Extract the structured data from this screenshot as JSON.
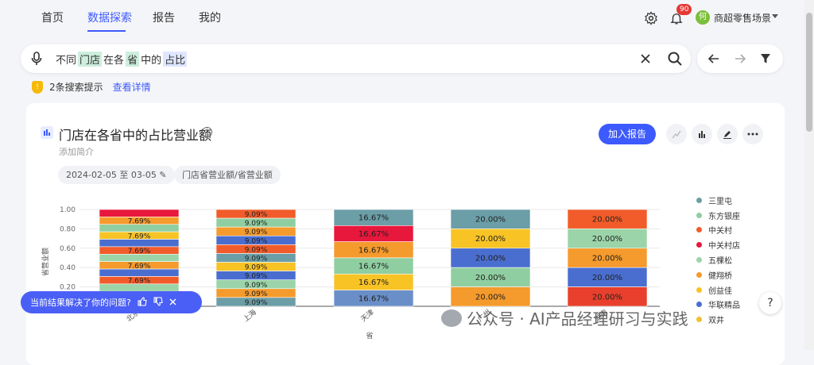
{
  "nav": {
    "items": [
      {
        "label": "首页",
        "active": false
      },
      {
        "label": "数据探索",
        "active": true
      },
      {
        "label": "报告",
        "active": false
      },
      {
        "label": "我的",
        "active": false
      }
    ],
    "notification_count": "90",
    "avatar_char": "何",
    "user_label": "商超零售场景"
  },
  "search": {
    "query_parts": [
      "不同",
      "门店",
      "在各",
      "省",
      "中的",
      "占比"
    ]
  },
  "tip": {
    "text": "2条搜索提示",
    "link": "查看详情"
  },
  "card": {
    "title": "门店在各省中的占比营业额",
    "subtitle": "添加简介",
    "date_range": "2024-02-05 至 03-05",
    "metric_chip": "门店省营业额/省营业额",
    "add_report": "加入报告"
  },
  "chart_data": {
    "type": "bar",
    "stacked": true,
    "categories": [
      "北京",
      "上海",
      "天津",
      "广州",
      "湖南"
    ],
    "ylabel": "省营业额",
    "xlabel": "省",
    "ylim": [
      0,
      1
    ],
    "yticks": [
      "1.00",
      "0.80",
      "0.60",
      "0.40",
      "0.20"
    ],
    "legend_position": "right",
    "series": [
      {
        "name": "三里屯",
        "color": "#6b9ea7"
      },
      {
        "name": "东方银座",
        "color": "#8fcea0"
      },
      {
        "name": "中关村",
        "color": "#f25c2a"
      },
      {
        "name": "中关村店",
        "color": "#e8173c"
      },
      {
        "name": "五棵松",
        "color": "#9bd4a8"
      },
      {
        "name": "健翔桥",
        "color": "#f59a2c"
      },
      {
        "name": "创益佳",
        "color": "#f7c325"
      },
      {
        "name": "华联精品",
        "color": "#4a6ed0"
      },
      {
        "name": "双井",
        "color": "#f0c030"
      }
    ],
    "stacks": [
      {
        "category": "北京",
        "segments": [
          {
            "color": "#e8173c",
            "label": ""
          },
          {
            "color": "#f59a2c",
            "label": "7.69%"
          },
          {
            "color": "#8fcea0",
            "label": ""
          },
          {
            "color": "#f7c325",
            "label": "7.69%"
          },
          {
            "color": "#4a6ed0",
            "label": ""
          },
          {
            "color": "#f25c2a",
            "label": "7.69%"
          },
          {
            "color": "#9bd4a8",
            "label": ""
          },
          {
            "color": "#f59a2c",
            "label": "7.69%"
          },
          {
            "color": "#4a6ed0",
            "label": ""
          },
          {
            "color": "#f25c2a",
            "label": "7.69%"
          },
          {
            "color": "#9bd4a8",
            "label": ""
          },
          {
            "color": "#6b9ea7",
            "label": ""
          },
          {
            "color": "#f0c030",
            "label": ""
          }
        ]
      },
      {
        "category": "上海",
        "segments": [
          {
            "color": "#f25c2a",
            "label": "9.09%"
          },
          {
            "color": "#8fcea0",
            "label": "9.09%"
          },
          {
            "color": "#f59a2c",
            "label": "9.09%"
          },
          {
            "color": "#4a6ed0",
            "label": "9.09%"
          },
          {
            "color": "#f25c2a",
            "label": "9.09%"
          },
          {
            "color": "#6b9ea7",
            "label": "9.09%"
          },
          {
            "color": "#f7c325",
            "label": "9.09%"
          },
          {
            "color": "#4a6ed0",
            "label": "9.09%"
          },
          {
            "color": "#9bd4a8",
            "label": "9.09%"
          },
          {
            "color": "#f59a2c",
            "label": "9.09%"
          },
          {
            "color": "#6b9ea7",
            "label": "9.09%"
          }
        ]
      },
      {
        "category": "天津",
        "segments": [
          {
            "color": "#6b9ea7",
            "label": "16.67%"
          },
          {
            "color": "#e8173c",
            "label": "16.67%"
          },
          {
            "color": "#f59a2c",
            "label": "16.67%"
          },
          {
            "color": "#8fcea0",
            "label": "16.67%"
          },
          {
            "color": "#f7c325",
            "label": "16.67%"
          },
          {
            "color": "#6a8fc8",
            "label": "16.67%"
          }
        ]
      },
      {
        "category": "广州",
        "segments": [
          {
            "color": "#6b9ea7",
            "label": "20.00%"
          },
          {
            "color": "#f7c325",
            "label": "20.00%"
          },
          {
            "color": "#4a6ed0",
            "label": "20.00%"
          },
          {
            "color": "#8fcea0",
            "label": "20.00%"
          },
          {
            "color": "#f59a2c",
            "label": "20.00%"
          }
        ]
      },
      {
        "category": "湖南",
        "segments": [
          {
            "color": "#f25c2a",
            "label": "20.00%"
          },
          {
            "color": "#9bd4a8",
            "label": "20.00%"
          },
          {
            "color": "#f59a2c",
            "label": "20.00%"
          },
          {
            "color": "#4a6ed0",
            "label": "20.00%"
          },
          {
            "color": "#e8402c",
            "label": "20.00%"
          }
        ]
      }
    ]
  },
  "feedback": {
    "question": "当前结果解决了你的问题?"
  },
  "watermark": {
    "text": "公众号 · AI产品经理研习与实践"
  },
  "colors": {
    "accent": "#3d5afe"
  }
}
